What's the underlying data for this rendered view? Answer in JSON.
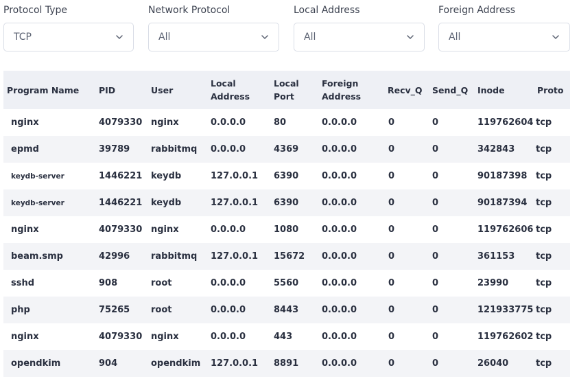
{
  "filters": [
    {
      "label": "Protocol Type",
      "value": "TCP"
    },
    {
      "label": "Network Protocol",
      "value": "All"
    },
    {
      "label": "Local Address",
      "value": "All"
    },
    {
      "label": "Foreign Address",
      "value": "All"
    }
  ],
  "table": {
    "headers": {
      "program": "Program Name",
      "pid": "PID",
      "user": "User",
      "local_address_1": "Local",
      "local_address_2": "Address",
      "local_port_1": "Local",
      "local_port_2": "Port",
      "foreign_address_1": "Foreign",
      "foreign_address_2": "Address",
      "recv_q": "Recv_Q",
      "send_q": "Send_Q",
      "inode": "Inode",
      "proto": "Proto"
    },
    "rows": [
      {
        "program": "nginx",
        "pid": "4079330",
        "user": "nginx",
        "local_address": "0.0.0.0",
        "local_port": "80",
        "foreign_address": "0.0.0.0",
        "recv_q": "0",
        "send_q": "0",
        "inode": "119762604",
        "proto": "tcp"
      },
      {
        "program": "epmd",
        "pid": "39789",
        "user": "rabbitmq",
        "local_address": "0.0.0.0",
        "local_port": "4369",
        "foreign_address": "0.0.0.0",
        "recv_q": "0",
        "send_q": "0",
        "inode": "342843",
        "proto": "tcp"
      },
      {
        "program": "keydb-server",
        "pid": "1446221",
        "user": "keydb",
        "local_address": "127.0.0.1",
        "local_port": "6390",
        "foreign_address": "0.0.0.0",
        "recv_q": "0",
        "send_q": "0",
        "inode": "90187398",
        "proto": "tcp"
      },
      {
        "program": "keydb-server",
        "pid": "1446221",
        "user": "keydb",
        "local_address": "127.0.0.1",
        "local_port": "6390",
        "foreign_address": "0.0.0.0",
        "recv_q": "0",
        "send_q": "0",
        "inode": "90187394",
        "proto": "tcp"
      },
      {
        "program": "nginx",
        "pid": "4079330",
        "user": "nginx",
        "local_address": "0.0.0.0",
        "local_port": "1080",
        "foreign_address": "0.0.0.0",
        "recv_q": "0",
        "send_q": "0",
        "inode": "119762606",
        "proto": "tcp"
      },
      {
        "program": "beam.smp",
        "pid": "42996",
        "user": "rabbitmq",
        "local_address": "127.0.0.1",
        "local_port": "15672",
        "foreign_address": "0.0.0.0",
        "recv_q": "0",
        "send_q": "0",
        "inode": "361153",
        "proto": "tcp"
      },
      {
        "program": "sshd",
        "pid": "908",
        "user": "root",
        "local_address": "0.0.0.0",
        "local_port": "5560",
        "foreign_address": "0.0.0.0",
        "recv_q": "0",
        "send_q": "0",
        "inode": "23990",
        "proto": "tcp"
      },
      {
        "program": "php",
        "pid": "75265",
        "user": "root",
        "local_address": "0.0.0.0",
        "local_port": "8443",
        "foreign_address": "0.0.0.0",
        "recv_q": "0",
        "send_q": "0",
        "inode": "121933775",
        "proto": "tcp"
      },
      {
        "program": "nginx",
        "pid": "4079330",
        "user": "nginx",
        "local_address": "0.0.0.0",
        "local_port": "443",
        "foreign_address": "0.0.0.0",
        "recv_q": "0",
        "send_q": "0",
        "inode": "119762602",
        "proto": "tcp"
      },
      {
        "program": "opendkim",
        "pid": "904",
        "user": "opendkim",
        "local_address": "127.0.0.1",
        "local_port": "8891",
        "foreign_address": "0.0.0.0",
        "recv_q": "0",
        "send_q": "0",
        "inode": "26040",
        "proto": "tcp"
      }
    ]
  }
}
